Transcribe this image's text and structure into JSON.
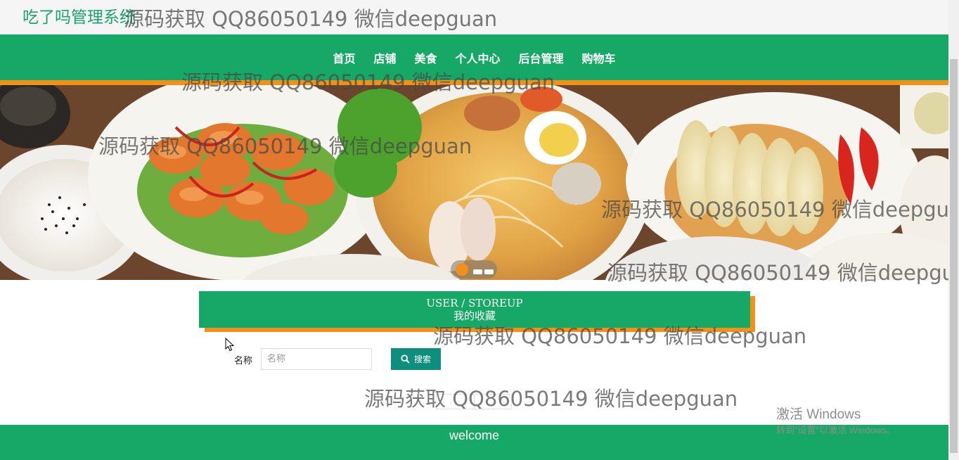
{
  "app": {
    "title": "吃了吗管理系统"
  },
  "nav": {
    "items": [
      {
        "label": "首页"
      },
      {
        "label": "店铺"
      },
      {
        "label": "美食"
      },
      {
        "label": "个人中心"
      },
      {
        "label": "后台管理"
      },
      {
        "label": "购物车"
      }
    ]
  },
  "banner": {
    "slide_count": 3,
    "active_slide": 1
  },
  "section": {
    "title_en": "USER / STOREUP",
    "title_cn": "我的收藏"
  },
  "search": {
    "label": "名称",
    "placeholder": "名称",
    "value": "",
    "button_label": "搜索"
  },
  "footer": {
    "text": "welcome"
  },
  "watermark": {
    "text": "源码获取 QQ86050149 微信deepguan"
  },
  "os_notice": {
    "title": "激活 Windows",
    "subtitle": "转到\"设置\"以激活 Windows。"
  },
  "colors": {
    "brand_green": "#16a866",
    "accent_orange": "#f2911a",
    "button_teal": "#0e8f7d"
  }
}
